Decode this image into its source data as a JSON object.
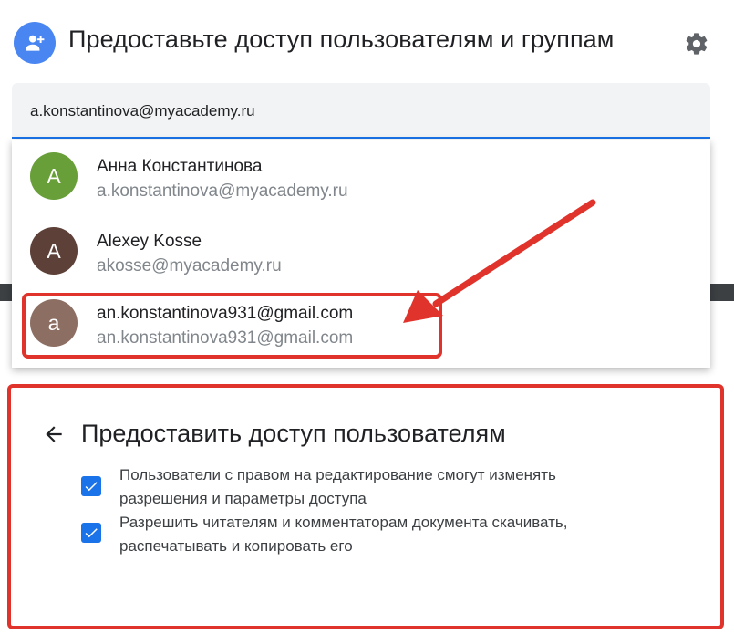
{
  "header": {
    "title": "Предоставьте доступ пользователям и группам",
    "add_people_icon": "person-add-icon",
    "settings_icon": "gear-icon"
  },
  "search": {
    "value": "a.konstantinova@myacademy.ru"
  },
  "suggestions": [
    {
      "initial": "A",
      "name": "Анна Константинова",
      "email": "a.konstantinova@myacademy.ru",
      "avatar_color": "#689f38"
    },
    {
      "initial": "A",
      "name": "Alexey Kosse",
      "email": "akosse@myacademy.ru",
      "avatar_color": "#5d4037"
    },
    {
      "initial": "a",
      "name": "an.konstantinova931@gmail.com",
      "email": "an.konstantinova931@gmail.com",
      "avatar_color": "#8d6e63"
    }
  ],
  "settings_panel": {
    "title": "Предоставить доступ пользователям",
    "back_icon": "arrow-back-icon",
    "options": [
      {
        "checked": true,
        "lines": [
          "Пользователи с правом на редактирование смогут изменять",
          "разрешения и параметры доступа"
        ]
      },
      {
        "checked": true,
        "lines": [
          "Разрешить читателям и комментаторам документа скачивать,",
          "распечатывать и копировать его"
        ]
      }
    ]
  },
  "colors": {
    "accent": "#1a73e8",
    "header_icon_bg": "#4a86f2",
    "annotation_red": "#e0332b"
  }
}
